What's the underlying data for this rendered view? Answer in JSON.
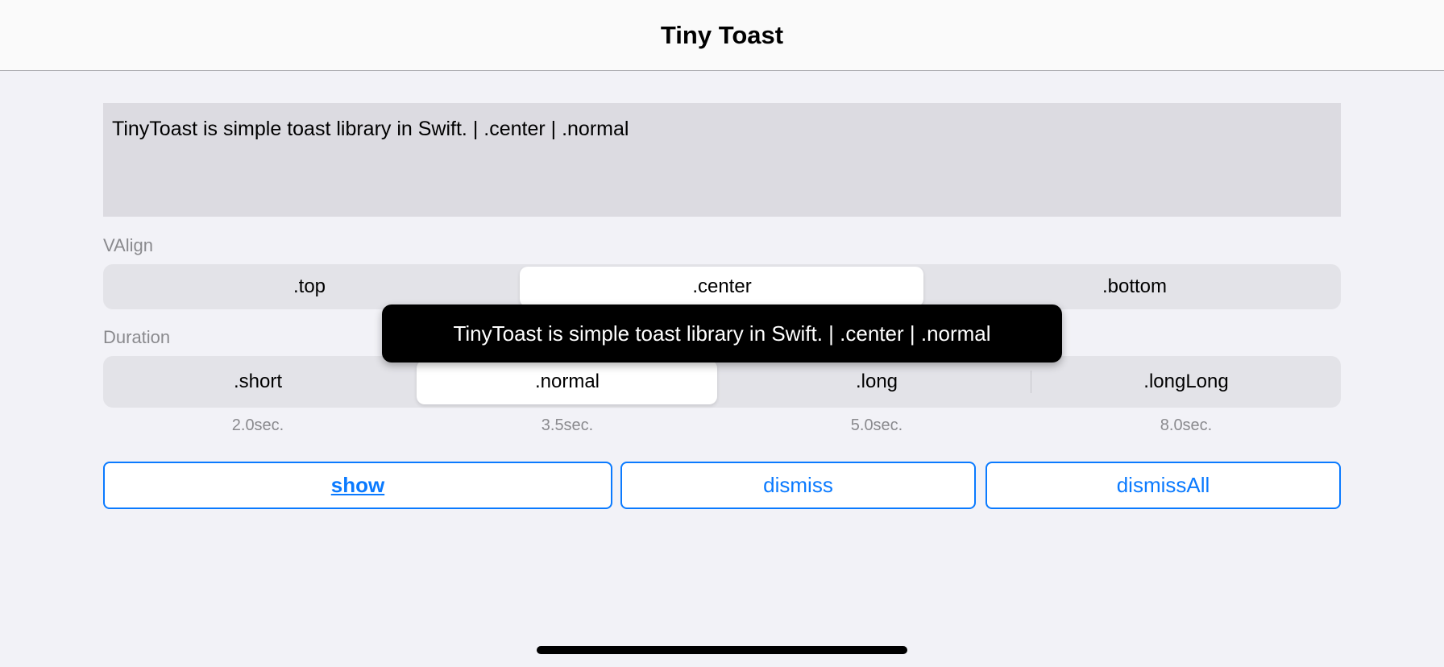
{
  "nav": {
    "title": "Tiny Toast"
  },
  "textview": {
    "value": "TinyToast is simple toast library in Swift. | .center | .normal"
  },
  "valign": {
    "label": "VAlign",
    "options": [
      ".top",
      ".center",
      ".bottom"
    ],
    "selected": ".center"
  },
  "duration": {
    "label": "Duration",
    "options": [
      ".short",
      ".normal",
      ".long",
      ".longLong"
    ],
    "selected": ".normal",
    "seconds": [
      "2.0sec.",
      "3.5sec.",
      "5.0sec.",
      "8.0sec."
    ]
  },
  "buttons": {
    "show": "show",
    "dismiss": "dismiss",
    "dismissAll": "dismissAll"
  },
  "toast": {
    "text": "TinyToast is simple toast library in Swift. | .center | .normal"
  },
  "colors": {
    "accent": "#0a7aff",
    "toast_bg": "#000000",
    "background": "#f2f2f7"
  }
}
